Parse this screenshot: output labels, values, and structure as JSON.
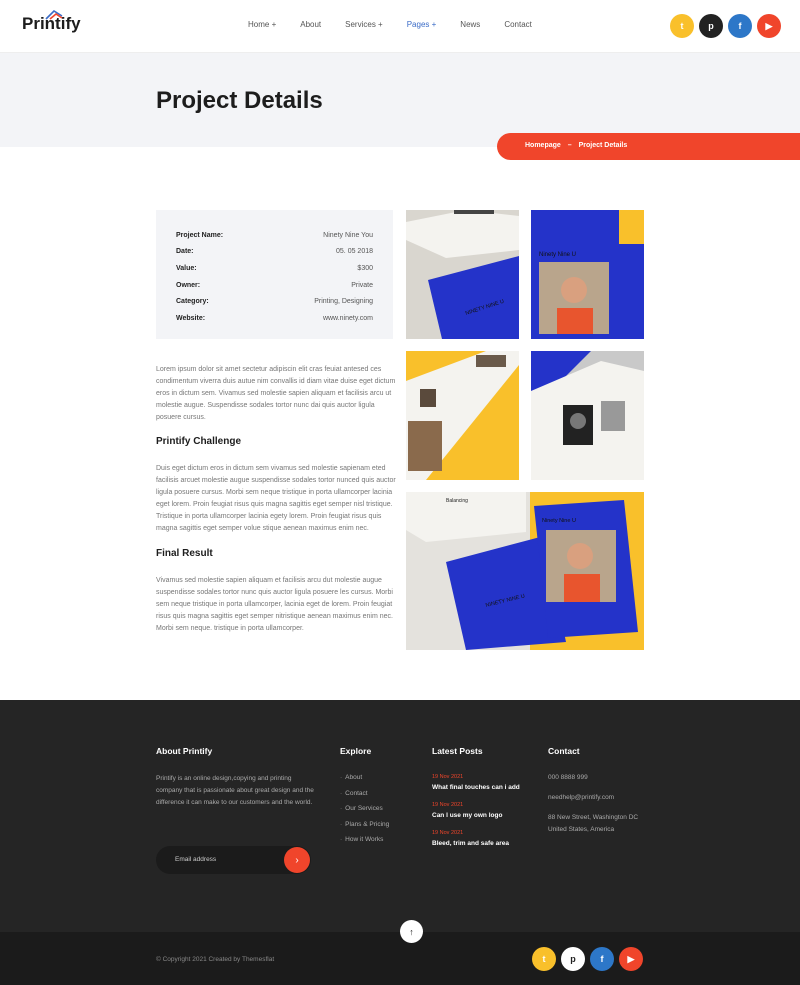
{
  "brand": {
    "name": "Printify"
  },
  "nav": {
    "items": [
      "Home +",
      "About",
      "Services +",
      "Pages +",
      "News",
      "Contact"
    ],
    "active_index": 3
  },
  "social": {
    "icons": [
      "twitter-icon",
      "pinterest-icon",
      "facebook-icon",
      "youtube-icon"
    ],
    "glyphs": [
      "t",
      "p",
      "f",
      "▶"
    ]
  },
  "banner": {
    "title": "Project Details"
  },
  "breadcrumb": {
    "home": "Homepage",
    "separator": "–",
    "current": "Project Details"
  },
  "project": {
    "rows": [
      {
        "label": "Project Name:",
        "value": "Ninety Nine You"
      },
      {
        "label": "Date:",
        "value": "05. 05 2018"
      },
      {
        "label": "Value:",
        "value": "$300"
      },
      {
        "label": "Owner:",
        "value": "Private"
      },
      {
        "label": "Category:",
        "value": "Printing, Designing"
      },
      {
        "label": "Website:",
        "value": "www.ninety.com"
      }
    ]
  },
  "content": {
    "intro": "Lorem ipsum dolor sit amet sectetur adipiscin elit cras feuiat antesed ces condimentum viverra duis autue nim convallis id diam vitae duise eget dictum eros in dictum sem. Vivamus sed molestie sapien aliquam et facilisis arcu ut molestie augue. Suspendisse sodales tortor nunc dai quis auctor ligula posuere cursus.",
    "challenge_title": "Printify Challenge",
    "challenge_text": "Duis eget dictum eros in dictum sem vivamus sed molestie sapienam eted facilisis arcuet molestie augue suspendisse sodales tortor nunced quis auctor ligula posuere cursus. Morbi sem neque tristique in porta ullamcorper lacinia eget lorem. Proin feugiat risus quis magna sagittis eget semper nisl tristique. Tristique in porta ullamcorper lacinia egety lorem. Proin feugiat risus quis magna sagittis eget semper volue stique aenean maximus enim nec.",
    "result_title": "Final Result",
    "result_text": "Vivamus sed molestie sapien aliquam et facilisis arcu dut molestie augue suspendisse sodales tortor nunc quis auctor ligula posuere les cursus. Morbi sem neque tristique in porta ullamcorper, lacinia eget de lorem. Proin feugiat risus quis magna sagittis eget semper nitristique aenean maximus enim nec. Morbi sem neque. tristique in porta ullamcorper."
  },
  "gallery": {
    "covers": [
      "Ninety Nine U",
      "Ninety Nine U"
    ],
    "book_text": "NINETY NINE U\nISSUE NO. 01\nOCT 2015 / DEC 2015",
    "open_book_text": "Balancing\nrelationship\nto work\nhealthy for us"
  },
  "footer": {
    "about_title": "About Printify",
    "about_text": "Printify is an online design,copying and printing company that is passionate about great design and the difference it can make to our customers and the world.",
    "email_placeholder": "Email address",
    "explore_title": "Explore",
    "explore_links": [
      "About",
      "Contact",
      "Our Services",
      "Plans & Pricing",
      "How it Works"
    ],
    "posts_title": "Latest Posts",
    "posts": [
      {
        "date": "19 Nov 2021",
        "title": "What final touches can i add"
      },
      {
        "date": "19 Nov 2021",
        "title": "Can I use my own logo"
      },
      {
        "date": "19 Nov 2021",
        "title": "Bleed, trim and safe area"
      }
    ],
    "contact_title": "Contact",
    "phone": "000 8888 999",
    "email": "needhelp@printify.com",
    "address": "88 New Street, Washington DC United States, America",
    "copyright": "© Copyright 2021 Created by Themesflat"
  },
  "colors": {
    "accent": "#f0452b",
    "nav_active": "#3b6cc7",
    "yellow": "#f9c02b",
    "blue": "#2433c9"
  }
}
